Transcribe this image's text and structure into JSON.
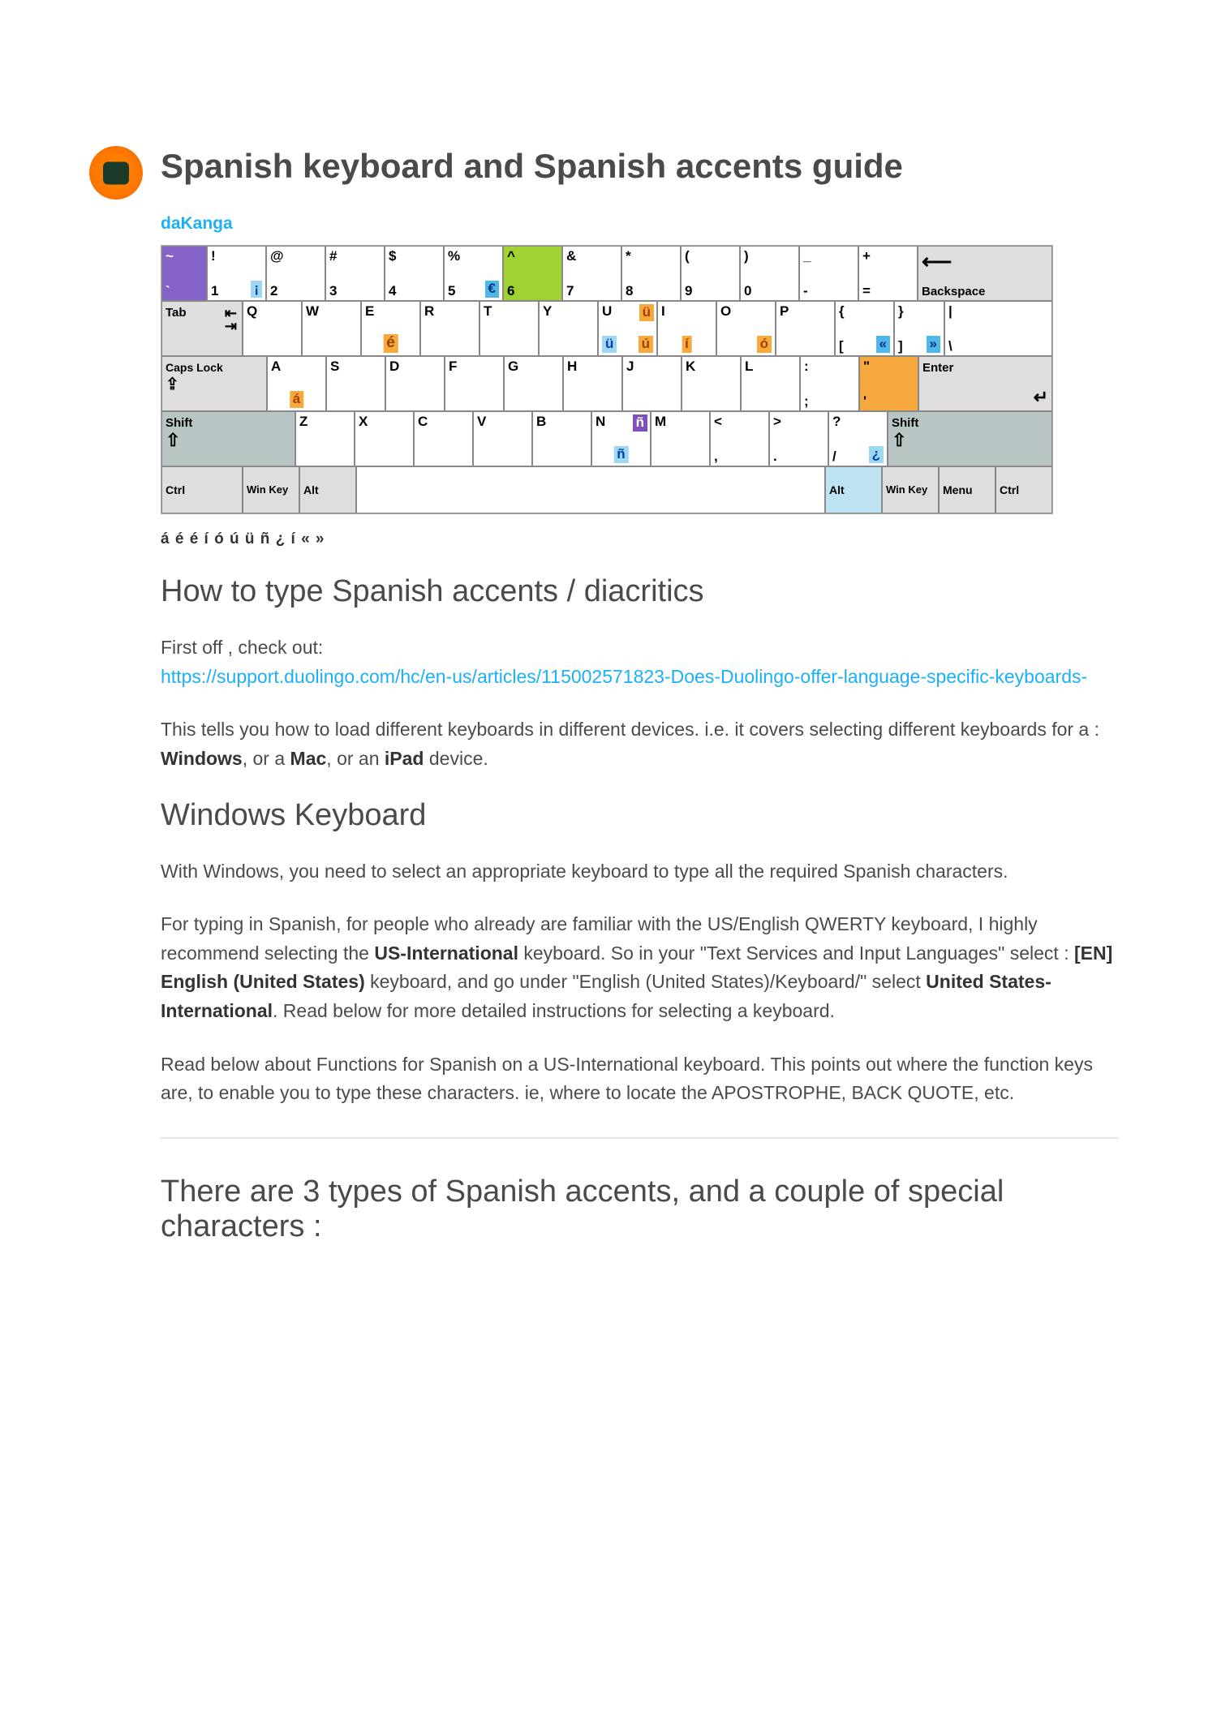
{
  "title": "Spanish keyboard and Spanish accents guide",
  "author": "daKanga",
  "keyboard": {
    "row1": {
      "tilde_top": "~",
      "tilde_bot": "`",
      "k1_top": "!",
      "k1_bot": "1",
      "k1_badge": "¡",
      "k2_top": "@",
      "k2_bot": "2",
      "k3_top": "#",
      "k3_bot": "3",
      "k4_top": "$",
      "k4_bot": "4",
      "k5_top": "%",
      "k5_bot": "5",
      "k5_badge": "€",
      "k6_top": "^",
      "k6_bot": "6",
      "k7_top": "&",
      "k7_bot": "7",
      "k8_top": "*",
      "k8_bot": "8",
      "k9_top": "(",
      "k9_bot": "9",
      "k0_top": ")",
      "k0_bot": "0",
      "kmin_top": "_",
      "kmin_bot": "-",
      "keq_top": "+",
      "keq_bot": "=",
      "backspace": "Backspace"
    },
    "row2": {
      "tab": "Tab",
      "q": "Q",
      "w": "W",
      "e": "E",
      "e_badge": "é",
      "r": "R",
      "t": "T",
      "y": "Y",
      "u": "U",
      "u_top_badge": "ü",
      "u_badge": "ü",
      "u_badge2": "ú",
      "i": "I",
      "i_badge": "í",
      "o": "O",
      "o_badge": "ó",
      "p": "P",
      "lb_top": "{",
      "lb_bot": "[",
      "lb_badge": "«",
      "rb_top": "}",
      "rb_bot": "]",
      "rb_badge": "»",
      "bs_top": "|",
      "bs_bot": "\\"
    },
    "row3": {
      "caps": "Caps Lock",
      "a": "A",
      "a_badge": "á",
      "s": "S",
      "d": "D",
      "f": "F",
      "g": "G",
      "h": "H",
      "j": "J",
      "k": "K",
      "l": "L",
      "semi_top": ":",
      "semi_bot": ";",
      "quote_top": "\"",
      "quote_bot": "'",
      "enter": "Enter"
    },
    "row4": {
      "shift": "Shift",
      "z": "Z",
      "x": "X",
      "c": "C",
      "v": "V",
      "b": "B",
      "n": "N",
      "n_top_badge": "ñ",
      "n_badge": "ñ",
      "m": "M",
      "comma_top": "<",
      "comma_bot": ",",
      "dot_top": ">",
      "dot_bot": ".",
      "slash_top": "?",
      "slash_bot": "/",
      "slash_badge": "¿",
      "shift_r": "Shift"
    },
    "row5": {
      "ctrl": "Ctrl",
      "win": "Win Key",
      "alt": "Alt",
      "alt_r": "Alt",
      "win_r": "Win Key",
      "menu": "Menu",
      "ctrl_r": "Ctrl"
    }
  },
  "accent_list": "á é é í ó ú ü ñ ¿ í « »",
  "sections": {
    "h_how": "How to type Spanish accents / diacritics",
    "p_first": "First off , check out:",
    "link1": "https://support.duolingo.com/hc/en-us/articles/115002571823-Does-Duolingo-offer-language-specific-keyboards-",
    "p_tells_a": "This tells you how to load different keyboards in different devices. i.e. it covers selecting different keyboards for a : ",
    "windows_b": "Windows",
    "or_a": ", or a ",
    "mac_b": "Mac",
    "or_an": ", or an ",
    "ipad_b": "iPad",
    "device_end": " device.",
    "h_win": "Windows Keyboard",
    "p_win1": "With Windows, you need to select an appropriate keyboard to type all the required Spanish characters.",
    "p_win2_a": "For typing in Spanish, for people who already are familiar with the US/English QWERTY keyboard, I highly recommend selecting the ",
    "usintl_b": "US-International",
    "p_win2_b": " keyboard. So in your \"Text Services and Input Languages\" select : ",
    "en_b": "[EN] English (United States)",
    "p_win2_c": " keyboard, and go under \"English (United States)/Keyboard/\" select ",
    "usintl2_b": "United States-International",
    "p_win2_d": ". Read below for more detailed instructions for selecting a keyboard.",
    "p_win3": "Read below about Functions for Spanish on a US-International keyboard. This points out where the function keys are, to enable you to type these characters. ie, where to locate the APOSTROPHE, BACK QUOTE, etc.",
    "h_three": "There are 3 types of Spanish accents, and a couple of special characters :"
  }
}
